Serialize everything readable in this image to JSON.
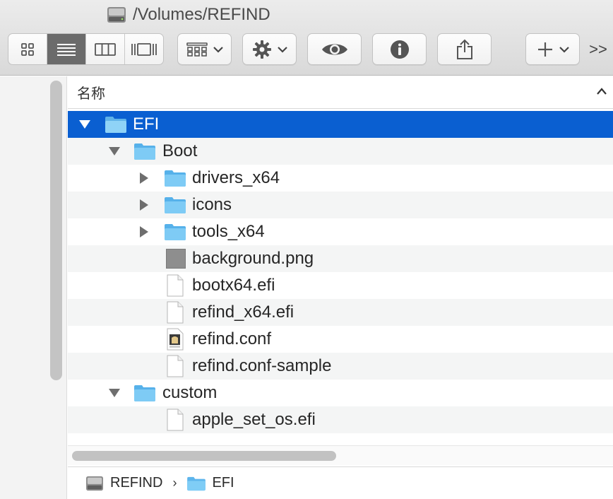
{
  "window": {
    "title": "/Volumes/REFIND"
  },
  "toolbar": {
    "view_modes": [
      "icon-view",
      "list-view",
      "column-view",
      "gallery-view"
    ],
    "active_view": "list-view",
    "group_icon": "group-grid-icon",
    "action_icon": "gear-icon",
    "quicklook_icon": "eye-icon",
    "info_icon": "info-icon",
    "share_icon": "share-icon",
    "new_icon": "plus-icon",
    "overflow_label": ">>"
  },
  "list": {
    "column_header": "名称",
    "rows": [
      {
        "name": "EFI",
        "kind": "folder",
        "depth": 0,
        "disclosure": "expanded",
        "selected": true
      },
      {
        "name": "Boot",
        "kind": "folder",
        "depth": 1,
        "disclosure": "expanded"
      },
      {
        "name": "drivers_x64",
        "kind": "folder",
        "depth": 2,
        "disclosure": "collapsed"
      },
      {
        "name": "icons",
        "kind": "folder",
        "depth": 2,
        "disclosure": "collapsed"
      },
      {
        "name": "tools_x64",
        "kind": "folder",
        "depth": 2,
        "disclosure": "collapsed"
      },
      {
        "name": "background.png",
        "kind": "image",
        "depth": 2,
        "disclosure": "none"
      },
      {
        "name": "bootx64.efi",
        "kind": "document",
        "depth": 2,
        "disclosure": "none"
      },
      {
        "name": "refind_x64.efi",
        "kind": "document",
        "depth": 2,
        "disclosure": "none"
      },
      {
        "name": "refind.conf",
        "kind": "config",
        "depth": 2,
        "disclosure": "none"
      },
      {
        "name": "refind.conf-sample",
        "kind": "document",
        "depth": 2,
        "disclosure": "none"
      },
      {
        "name": "custom",
        "kind": "folder",
        "depth": 1,
        "disclosure": "expanded"
      },
      {
        "name": "apple_set_os.efi",
        "kind": "document",
        "depth": 2,
        "disclosure": "none"
      }
    ]
  },
  "pathbar": {
    "items": [
      {
        "label": "REFIND",
        "icon": "drive-icon"
      },
      {
        "label": "EFI",
        "icon": "folder-icon"
      }
    ],
    "separator": "›"
  },
  "colors": {
    "selection": "#0a5fd1",
    "folder": "#6cc3f2",
    "toolbar_bg": "#e0e0e0",
    "active_view": "#6b6b6b"
  }
}
